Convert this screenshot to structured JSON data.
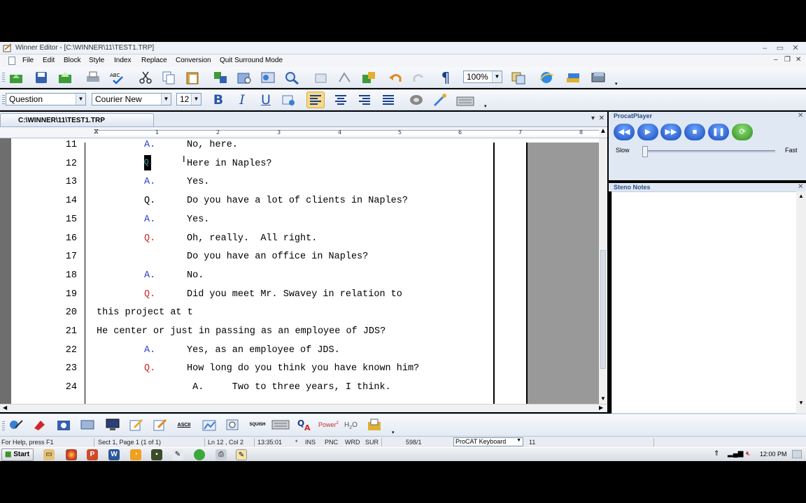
{
  "window": {
    "title": "Winner Editor - [C:\\WINNER\\11\\TEST1.TRP]",
    "min": "–",
    "max": "▭",
    "close": "✕"
  },
  "menu": [
    "File",
    "Edit",
    "Block",
    "Style",
    "Index",
    "Replace",
    "Conversion",
    "Quit Surround Mode"
  ],
  "mdi": {
    "min": "–",
    "restore": "❐",
    "close": "✕"
  },
  "toolbar": {
    "zoom": "100%",
    "style_value": "Question",
    "font_value": "Courier New",
    "size_value": "12",
    "bold": "B",
    "italic": "I",
    "underline": "U"
  },
  "document": {
    "tab_title": "C:\\WINNER\\11\\TEST1.TRP",
    "ruler_labels": [
      "1",
      "2",
      "3",
      "4",
      "5",
      "6",
      "7",
      "8"
    ],
    "lines": [
      {
        "num": "11",
        "tag": "A.",
        "tag_type": "A",
        "text": "No, here."
      },
      {
        "num": "12",
        "tag": "Q.",
        "tag_type": "cursor",
        "text": "Here in Naples?"
      },
      {
        "num": "13",
        "tag": "A.",
        "tag_type": "A",
        "text": "Yes."
      },
      {
        "num": "14",
        "tag": "Q.",
        "tag_type": "Qblack",
        "text": "Do you have a lot of clients in Naples?"
      },
      {
        "num": "15",
        "tag": "A.",
        "tag_type": "A",
        "text": "Yes."
      },
      {
        "num": "16",
        "tag": "Q.",
        "tag_type": "Q",
        "text": "Oh, really.  All right."
      },
      {
        "num": "17",
        "tag": "",
        "tag_type": "none",
        "text": "Do you have an office in Naples?"
      },
      {
        "num": "18",
        "tag": "A.",
        "tag_type": "A",
        "text": "No."
      },
      {
        "num": "19",
        "tag": "Q.",
        "tag_type": "Q",
        "text": "Did you meet Mr. Swavey in relation to"
      },
      {
        "num": "20",
        "tag": "",
        "tag_type": "cont",
        "text": "this project at t"
      },
      {
        "num": "21",
        "tag": "",
        "tag_type": "cont",
        "text": "He center or just in passing as an employee of JDS?"
      },
      {
        "num": "22",
        "tag": "A.",
        "tag_type": "A",
        "text": "Yes, as an employee of JDS."
      },
      {
        "num": "23",
        "tag": "Q.",
        "tag_type": "Q",
        "text": "How long do you think you have known him?"
      },
      {
        "num": "24",
        "tag": "",
        "tag_type": "inline",
        "text": " A.     Two to three years, I think."
      }
    ]
  },
  "procat": {
    "title": "ProcatPlayer",
    "slow": "Slow",
    "fast": "Fast",
    "speed_fraction": 0.0,
    "buttons": [
      "rewind-icon",
      "play-icon",
      "fast-forward-icon",
      "stop-icon",
      "pause-icon",
      "sync-icon"
    ]
  },
  "steno": {
    "title": "Steno Notes"
  },
  "bottom_toolbar": {
    "ascii": "ASCII",
    "squish": "SQUISH",
    "power": "Power",
    "power_sup": "2",
    "h2o": "H",
    "h2o_sub": "2",
    "h2o_tail": "O"
  },
  "status": {
    "help": "For Help, press F1",
    "section": "Sect 1, Page 1 (1 of 1)",
    "position": "Ln 12 , Col 2",
    "time": "13:35:01",
    "star": "*",
    "ins": "INS",
    "pnc": "PNC",
    "wrd": "WRD",
    "sur": "SUR",
    "counter": "598/1",
    "keyboard": "ProCAT Keyboard",
    "dict": "11"
  },
  "taskbar": {
    "start": "Start",
    "clock": "12:00 PM"
  },
  "colors": {
    "answer": "#2840c8",
    "question": "#d0282a",
    "accent": "#1547b8"
  }
}
